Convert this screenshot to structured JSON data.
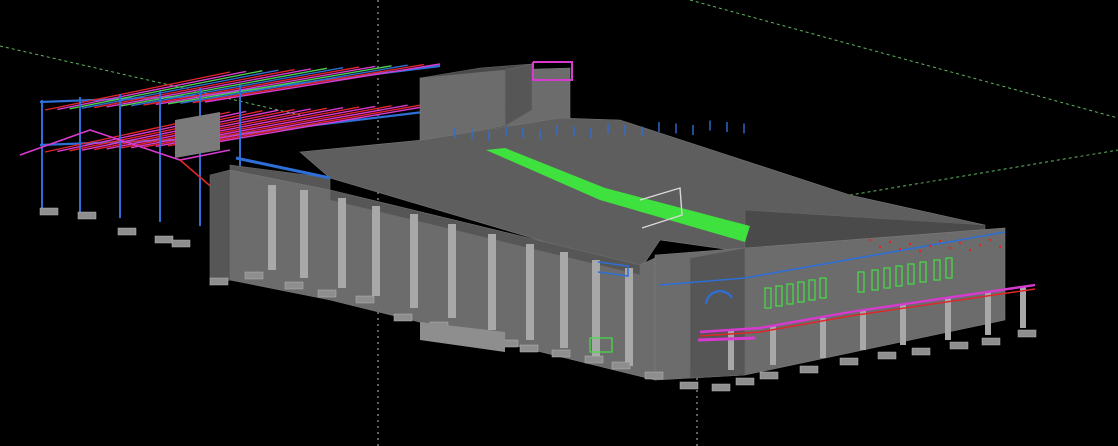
{
  "viewport": {
    "background": "#000000",
    "colors": {
      "guide": "#5fb85f",
      "guide_vertical": "#bfbfbf",
      "roof": "#5e5e5e",
      "roof_dark": "#4a4a4a",
      "wall": "#6c6c6c",
      "wall_dark": "#565656",
      "column": "#a8a8a8",
      "footing": "#8e8e8e",
      "steel_blue": "#2d6fd6",
      "steel_magenta": "#d83ad0",
      "steel_red": "#e0262a",
      "steel_green": "#4fd04f",
      "window_green": "#44e044",
      "highlight_green": "#3cf03c"
    }
  }
}
